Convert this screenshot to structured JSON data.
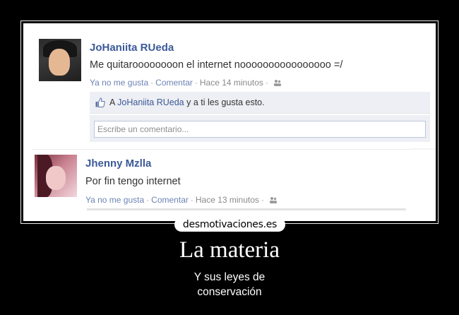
{
  "post1": {
    "author": "JoHaniita RUeda",
    "text": "Me quitaroooooooon el internet noooooooooooooooo =/",
    "unlike": "Ya no me gusta",
    "comment": "Comentar",
    "time": "Hace 14 minutos",
    "likes": {
      "prefix": "A",
      "name": "JoHaniita RUeda",
      "suffix": "y a ti les gusta esto."
    },
    "comment_placeholder": "Escribe un comentario..."
  },
  "post2": {
    "author": "Jhenny Mzlla",
    "text": "Por fin tengo internet",
    "unlike": "Ya no me gusta",
    "comment": "Comentar",
    "time": "Hace 13 minutos"
  },
  "site": "desmotivaciones.es",
  "poster": {
    "title": "La materia",
    "subtitle_line1": "Y sus leyes de",
    "subtitle_line2": "conservación"
  },
  "icons": {
    "like": "thumbs-up-icon",
    "audience": "friends-icon"
  },
  "colors": {
    "link": "#3b5998",
    "meta_link": "#6d84b4",
    "like_box_bg": "#edeff4"
  }
}
